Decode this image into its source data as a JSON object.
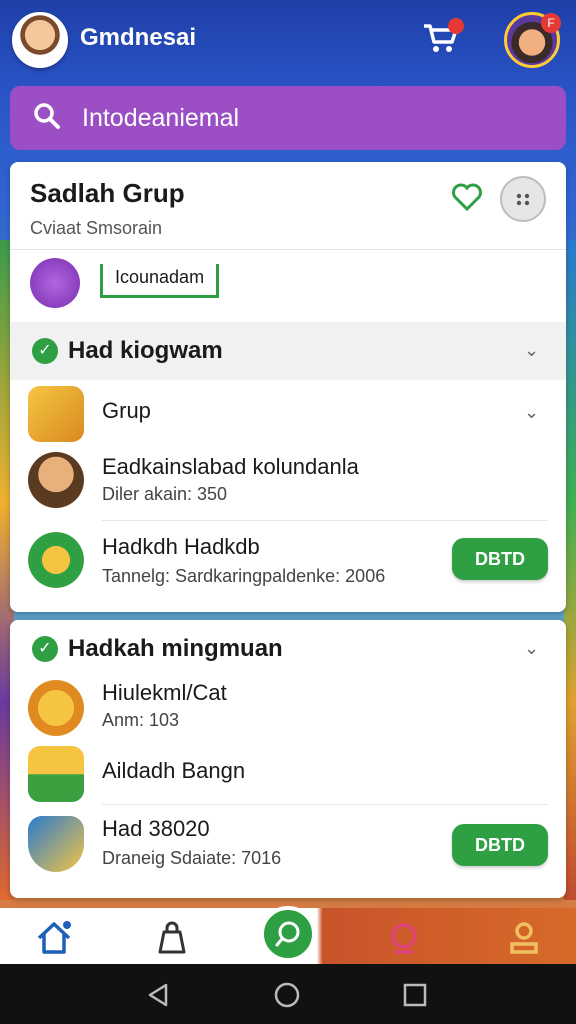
{
  "header": {
    "app_title": "Gmdnesai",
    "cart_badge": "",
    "profile_badge": "F"
  },
  "search": {
    "text": "Intodeaniemal"
  },
  "group": {
    "title": "Sadlah Grup",
    "subtitle": "Cviaat Smsorain",
    "category_chip": "Icounadam"
  },
  "sections": [
    {
      "title": "Had kiogwam",
      "items": [
        {
          "name": "Grup"
        },
        {
          "name": "Eadkainslabad kolundanla",
          "meta": "Diler akain: 350"
        },
        {
          "name": "Hadkdh Hadkdb",
          "meta": "Tannelg: Sardkaringpaldenke: 2006",
          "button": "DBTD"
        }
      ]
    },
    {
      "title": "Hadkah mingmuan",
      "items": [
        {
          "name": "Hiulekml/Cat",
          "meta": "Anm: 103"
        },
        {
          "name": "Aildadh Bangn"
        },
        {
          "name": "Had 38020",
          "meta": "Draneig Sdaiate: 7016",
          "button": "DBTD"
        }
      ]
    }
  ],
  "colors": {
    "accent_green": "#2ea043",
    "search_purple": "#9c4fc4",
    "badge_red": "#e53935"
  }
}
